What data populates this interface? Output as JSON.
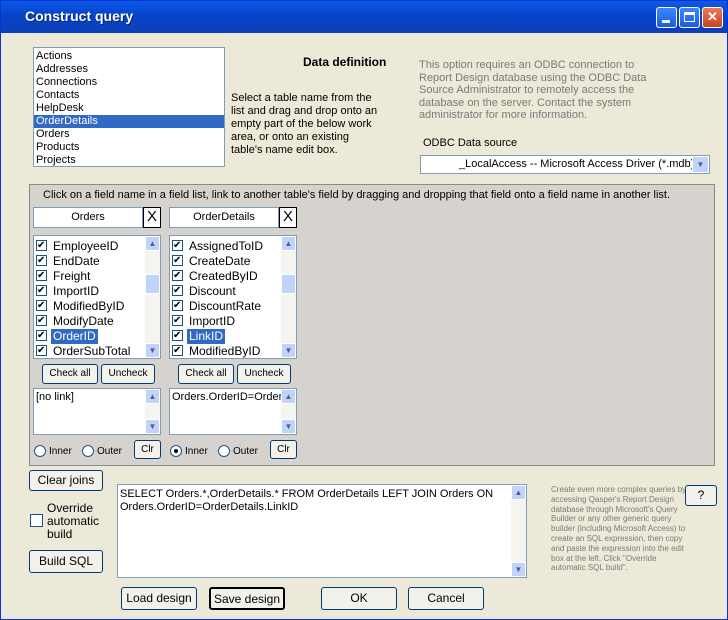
{
  "window": {
    "title": "Construct query"
  },
  "tables_list": [
    "Actions",
    "Addresses",
    "Connections",
    "Contacts",
    "HelpDesk",
    "OrderDetails",
    "Orders",
    "Products",
    "Projects"
  ],
  "tables_selected_index": 5,
  "data_definition": {
    "heading": "Data definition",
    "instructions": "Select a table name from the list and drag and drop onto an empty part of the below work area, or onto an existing table's name edit box."
  },
  "odbc": {
    "note": "This option requires an ODBC connection to Report Design database using the ODBC Data Source Administrator to remotely access the database on the server. Contact the system administrator for more information.",
    "label": "ODBC Data source",
    "value": "_LocalAccess -- Microsoft Access Driver (*.mdb)"
  },
  "work_area": {
    "instruction": "Click on a field name in a field list, link to another table's field by dragging and dropping that field onto a field name in another list.",
    "tables": [
      {
        "name": "Orders",
        "fields": [
          "EmployeeID",
          "EndDate",
          "Freight",
          "ImportID",
          "ModifiedByID",
          "ModifyDate",
          "OrderID",
          "OrderSubTotal"
        ],
        "selected_index": 6,
        "link_text": "[no link]",
        "join": "none",
        "check_all_label": "Check all",
        "uncheck_label": "Uncheck",
        "inner_label": "Inner",
        "outer_label": "Outer",
        "clr_label": "Clr",
        "close_label": "X"
      },
      {
        "name": "OrderDetails",
        "fields": [
          "AssignedToID",
          "CreateDate",
          "CreatedByID",
          "Discount",
          "DiscountRate",
          "ImportID",
          "LinkID",
          "ModifiedByID"
        ],
        "selected_index": 6,
        "link_text": "Orders.OrderID=OrderDetails.LinkID",
        "join": "inner",
        "check_all_label": "Check all",
        "uncheck_label": "Uncheck",
        "inner_label": "Inner",
        "outer_label": "Outer",
        "clr_label": "Clr",
        "close_label": "X"
      }
    ]
  },
  "bottom": {
    "clear_joins_label": "Clear joins",
    "override_label": "Override automatic build",
    "build_sql_label": "Build SQL",
    "sql_text": "SELECT Orders.*,OrderDetails.* FROM  OrderDetails LEFT JOIN Orders ON Orders.OrderID=OrderDetails.LinkID",
    "help_note": "Create even more complex queries by accessing Qasper's Report Design database through Microsoft's Query Builder or any other generic query builder (including Microsoft Access) to create an SQL expression, then copy and paste the expression into the edit box at the left. Click \"Override automatic SQL build\".",
    "help_button_label": "?",
    "load_design_label": "Load design",
    "save_design_label": "Save design",
    "ok_label": "OK",
    "cancel_label": "Cancel"
  }
}
